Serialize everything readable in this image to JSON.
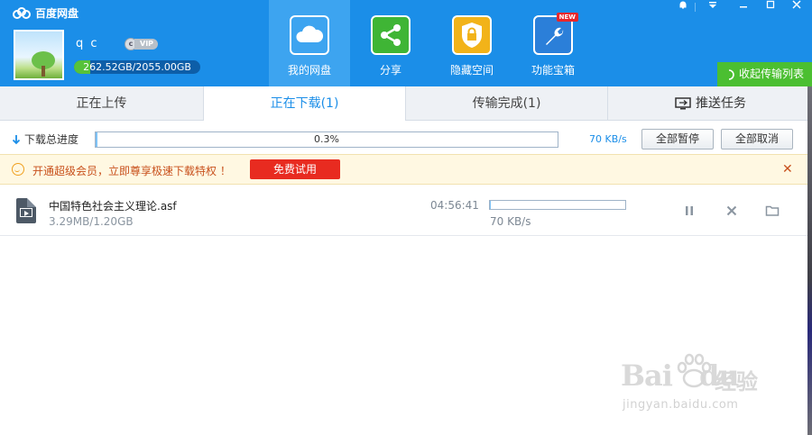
{
  "app": {
    "title": "百度网盘"
  },
  "user": {
    "name": "q    c",
    "vip_label": "VIP",
    "quota_text": "262.52GB/2055.00GB",
    "quota_used_fraction": 0.128
  },
  "nav": {
    "items": [
      {
        "label": "我的网盘",
        "icon": "cloud-icon",
        "active": true
      },
      {
        "label": "分享",
        "icon": "share-icon",
        "active": false
      },
      {
        "label": "隐藏空间",
        "icon": "lock-icon",
        "active": false
      },
      {
        "label": "功能宝箱",
        "icon": "wrench-icon",
        "active": false,
        "badge": "NEW"
      }
    ]
  },
  "window_controls": {
    "icons": [
      "notification-icon",
      "menu-icon",
      "minimize-icon",
      "maximize-icon",
      "close-icon"
    ]
  },
  "collapse_button": {
    "label": "收起传输列表"
  },
  "tabs": [
    {
      "label": "正在上传",
      "active": false
    },
    {
      "label": "正在下载(1)",
      "active": true
    },
    {
      "label": "传输完成(1)",
      "active": false
    }
  ],
  "push_task": {
    "label": "推送任务"
  },
  "progress": {
    "label": "下载总进度",
    "percent_text": "0.3%",
    "percent": 0.3,
    "speed": "70 KB/s",
    "pause_all": "全部暂停",
    "cancel_all": "全部取消"
  },
  "banner": {
    "message": "开通超级会员，立即尊享极速下载特权 ！",
    "button": "免费试用",
    "colors": {
      "background": "#fff8e2",
      "text": "#c8501c",
      "button": "#e82b20"
    }
  },
  "downloads": [
    {
      "name": "中国特色社会主义理论.asf",
      "size": "3.29MB/1.20GB",
      "eta": "04:56:41",
      "speed": "70 KB/s",
      "progress_percent": 0.3
    }
  ],
  "watermark": {
    "brand": "Bai",
    "brand_tail": "du",
    "brand_cn": "经验",
    "url": "jingyan.baidu.com"
  },
  "colors": {
    "primary": "#1b8ee8",
    "active_nav": "#3da4f0",
    "collapse_button": "#4bbf31"
  }
}
